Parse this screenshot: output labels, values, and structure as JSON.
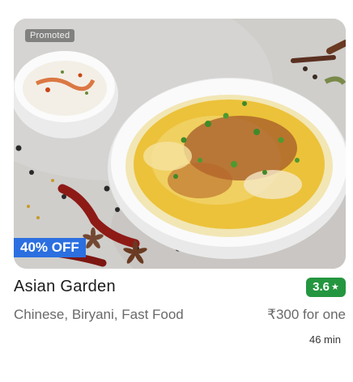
{
  "restaurant": {
    "name": "Asian Garden",
    "rating": "3.6",
    "rating_icon": "star-icon",
    "cuisines": "Chinese, Biryani, Fast Food",
    "price": "₹300 for one",
    "eta": "46 min"
  },
  "tags": {
    "promoted": "Promoted",
    "offer": "40% OFF"
  },
  "colors": {
    "offer_badge": "#2b6fe0",
    "rating_badge": "#24963f",
    "name_text": "#1c1c1c",
    "secondary_text": "#696969"
  }
}
